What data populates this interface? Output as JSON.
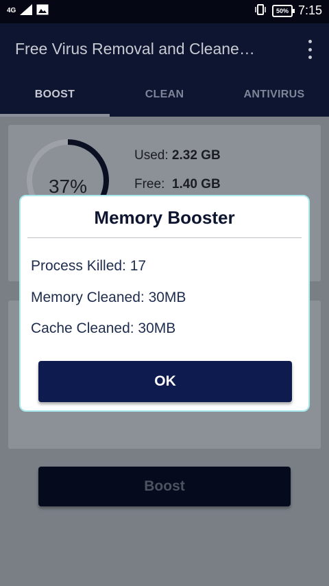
{
  "statusbar": {
    "network": "4G",
    "signal_icon": "signal-bars-icon",
    "image_icon": "gallery-notification-icon",
    "vibrate_icon": "vibrate-icon",
    "battery": "50%",
    "time": "7:15"
  },
  "appbar": {
    "title": "Free Virus Removal and Cleane…",
    "menu_icon": "more-vert-icon",
    "tabs": [
      "BOOST",
      "CLEAN",
      "ANTIVIRUS"
    ],
    "active_tab": "BOOST"
  },
  "memory": {
    "percent_label": "37%",
    "percent_value": 0.37,
    "used_label": "Used:",
    "used_value": "2.32 GB",
    "free_label": "Free:",
    "free_value": "1.40 GB"
  },
  "boost_button": "Boost",
  "dialog": {
    "title": "Memory Booster",
    "lines": [
      "Process Killed: 17",
      "Memory Cleaned: 30MB",
      "Cache Cleaned: 30MB"
    ],
    "ok_label": "OK"
  },
  "colors": {
    "appbar": "#0e1530",
    "dialog_button": "#0e1b4f",
    "dialog_border": "#a8e8ef",
    "scrim": "#7a7f86"
  }
}
